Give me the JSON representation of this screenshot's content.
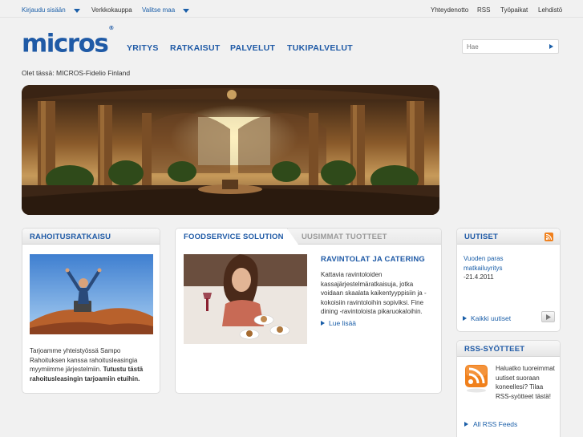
{
  "topbar": {
    "login": "Kirjaudu sisään",
    "shop": "Verkkokauppa",
    "country": "Valitse maa",
    "contact": "Yhteydenotto",
    "rss": "RSS",
    "jobs": "Työpaikat",
    "press": "Lehdistö"
  },
  "logo": {
    "text": "micros",
    "mark": "®"
  },
  "nav": [
    "YRITYS",
    "RATKAISUT",
    "PALVELUT",
    "TUKIPALVELUT"
  ],
  "search": {
    "placeholder": "Hae",
    "value": ""
  },
  "breadcrumb": "Olet tässä: MICROS-Fidelio Finland",
  "financing": {
    "title": "RAHOITUSRATKAISU",
    "text_plain": "Tarjoamme yhteistyössä Sampo Rahoituksen kanssa rahoitusleasingia myymiimme järjestelmiin. ",
    "text_bold": "Tutustu tästä rahoitusleasingin tarjoamiin etuihin."
  },
  "tabs": {
    "active": "FOODSERVICE SOLUTION",
    "inactive": "UUSIMMAT TUOTTEET"
  },
  "feature": {
    "heading": "RAVINTOLAT JA CATERING",
    "body": "Kattavia ravintoloiden kassajärjestelmäratkaisuja, jotka voidaan skaalata kaikentyyppisiin ja -kokoisiin ravintoloihin sopiviksi. Fine dining -ravintoloista pikaruokaloihin.",
    "link": "Lue lisää"
  },
  "news": {
    "title": "UUTISET",
    "item_title": "Vuoden paras matkailuyritys",
    "item_date": "-21.4.2011",
    "all_link": "Kaikki uutiset"
  },
  "rss": {
    "title": "RSS-SYÖTTEET",
    "text": "Haluatko tuoreimmat uutiset suoraan koneellesi? Tilaa RSS-syötteet tästä!",
    "all_link": "All RSS Feeds"
  },
  "colors": {
    "brand_blue": "#1f5aa6",
    "link_blue": "#1a5ea8",
    "rss_orange": "#f0801c",
    "background": "#f1f1f1"
  }
}
